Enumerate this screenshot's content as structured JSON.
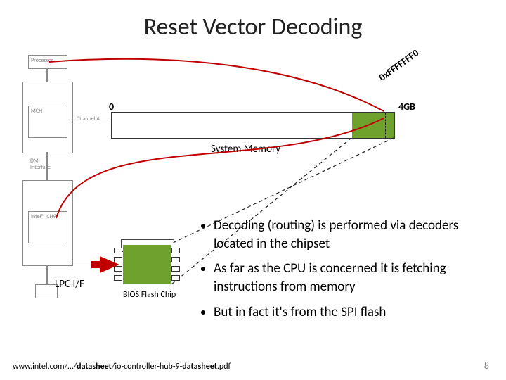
{
  "title": "Reset Vector Decoding",
  "mem": {
    "zero": "0",
    "top": "4GB",
    "addr": "0xFFFFFFF0",
    "label": "System Memory"
  },
  "bios": {
    "label": "BIOS Flash Chip"
  },
  "lpc": {
    "label": "LPC I/F"
  },
  "cpu": {
    "label": "Processor"
  },
  "mch": {
    "label": "MCH"
  },
  "ich": {
    "label": "Intel® ICH9"
  },
  "dmi": {
    "label": "DMI Interface"
  },
  "chan": {
    "label": "Channel A"
  },
  "bullets": [
    "Decoding (routing) is performed via decoders located in the chipset",
    "As far as the CPU is concerned it is fetching instructions from memory",
    "But in fact it's from the SPI flash"
  ],
  "footer": {
    "pre": "www.intel.com/…/",
    "b1": "datasheet",
    "mid": "/io-controller-hub-9-",
    "b2": "datasheet",
    "post": ".pdf"
  },
  "page": "8"
}
